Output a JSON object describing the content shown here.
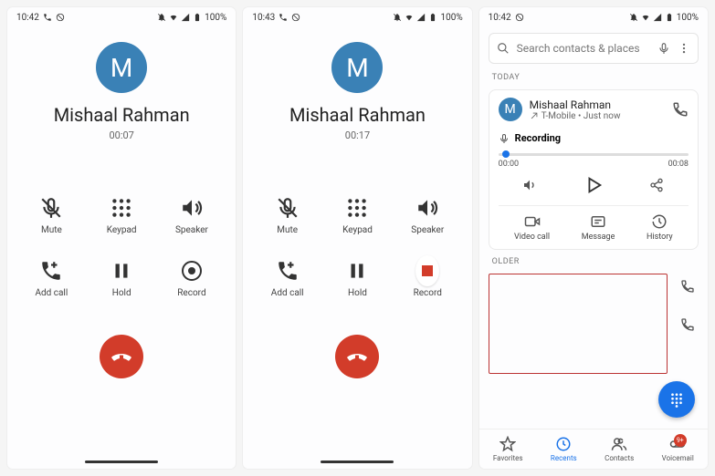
{
  "statusbar": {
    "battery": "100%"
  },
  "phone1": {
    "time": "10:42",
    "avatar_initial": "M",
    "caller_name": "Mishaal Rahman",
    "duration": "00:07",
    "buttons": {
      "mute": "Mute",
      "keypad": "Keypad",
      "speaker": "Speaker",
      "addcall": "Add call",
      "hold": "Hold",
      "record": "Record"
    }
  },
  "phone2": {
    "time": "10:43",
    "avatar_initial": "M",
    "caller_name": "Mishaal Rahman",
    "duration": "00:17",
    "buttons": {
      "mute": "Mute",
      "keypad": "Keypad",
      "speaker": "Speaker",
      "addcall": "Add call",
      "hold": "Hold",
      "record": "Record"
    }
  },
  "phone3": {
    "time": "10:42",
    "search_placeholder": "Search contacts & places",
    "today_label": "TODAY",
    "older_label": "OLDER",
    "entry": {
      "avatar_initial": "M",
      "name": "Mishaal Rahman",
      "subtitle": "T-Mobile • Just now"
    },
    "recording": {
      "label": "Recording",
      "t_start": "00:00",
      "t_end": "00:08"
    },
    "actions": {
      "video": "Video call",
      "message": "Message",
      "history": "History"
    },
    "nav": {
      "favorites": "Favorites",
      "recents": "Recents",
      "contacts": "Contacts",
      "voicemail": "Voicemail",
      "voicemail_badge": "9+"
    }
  }
}
